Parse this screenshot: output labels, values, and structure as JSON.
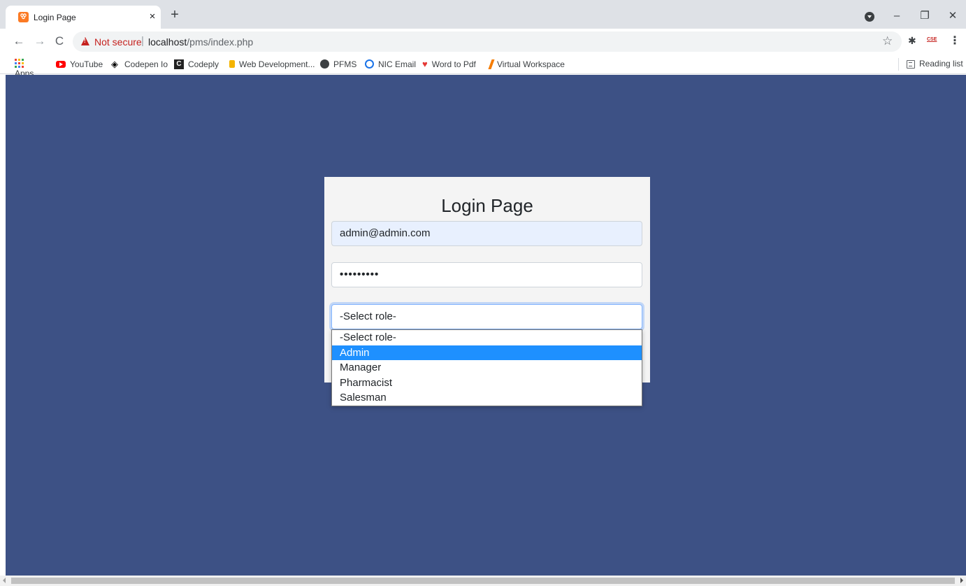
{
  "browser": {
    "tab_title": "Login Page",
    "tab_close": "×",
    "new_tab": "+",
    "window_controls": {
      "minimize": "–",
      "restore": "❐",
      "close": "✕"
    },
    "nav": {
      "back": "←",
      "forward": "→",
      "reload": "C"
    },
    "security_label": "Not secure",
    "url_host": "localhost",
    "url_path": "/pms/index.php",
    "icons": {
      "star": "☆",
      "extensions": "✱",
      "menu": "⋮",
      "cse": "CSE"
    }
  },
  "bookmarks": [
    {
      "label": "Apps",
      "icon": "apps-icon"
    },
    {
      "label": "YouTube",
      "icon": "youtube-icon"
    },
    {
      "label": "Codepen Io",
      "icon": "codepen-icon"
    },
    {
      "label": "Codeply",
      "icon": "codeply-icon"
    },
    {
      "label": "Web Development...",
      "icon": "webdev-icon"
    },
    {
      "label": "PFMS",
      "icon": "globe-icon"
    },
    {
      "label": "NIC Email",
      "icon": "nic-icon"
    },
    {
      "label": "Word to Pdf",
      "icon": "heart-icon"
    },
    {
      "label": "Virtual Workspace",
      "icon": "vw-icon"
    }
  ],
  "reading_list": "Reading list",
  "login": {
    "title": "Login Page",
    "email_value": "admin@admin.com",
    "password_value": "•••••••••",
    "role_value": "-Select role-",
    "role_options": [
      "-Select role-",
      "Admin",
      "Manager",
      "Pharmacist",
      "Salesman"
    ],
    "highlighted_option": "Admin"
  },
  "colors": {
    "page_background": "#3d5185",
    "card_background": "#f4f4f4",
    "option_highlight": "#1e90ff",
    "not_secure": "#c5221f"
  }
}
